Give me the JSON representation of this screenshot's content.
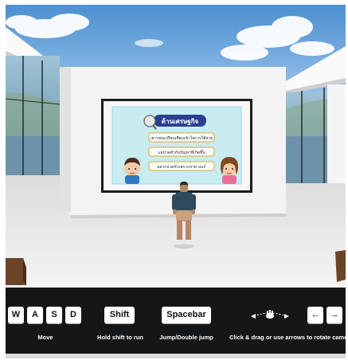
{
  "scene": {
    "presentation": {
      "title": "ด้านเศรษฐกิจ",
      "lines": [
        "เยาวชนเปรียบเทียบเข้าใจการใช้จ่าย",
        "แม่ปวดหัวกับปัญหาที่เกิดขึ้น",
        "อยากปวดหัวเพราะหาทางแก้"
      ]
    }
  },
  "controls": {
    "move": {
      "keys": [
        "W",
        "A",
        "S",
        "D"
      ],
      "label": "Move"
    },
    "run": {
      "key": "Shift",
      "label": "Hold shift to run"
    },
    "jump": {
      "key": "Spacebar",
      "label": "Jump/Double jump"
    },
    "rotate": {
      "icon": "drag-hand-icon",
      "keys": [
        "←",
        "→"
      ],
      "label": "Click & drag or use arrows to rotate camera"
    }
  },
  "colors": {
    "sky": "#5f9fd8",
    "wall": "#f1f1f1",
    "floor": "#e8e8e8",
    "bar": "#151617",
    "slide_bg": "#c8ecf0",
    "slide_title_bg": "#2b3e92",
    "highlight": "#e02020"
  }
}
